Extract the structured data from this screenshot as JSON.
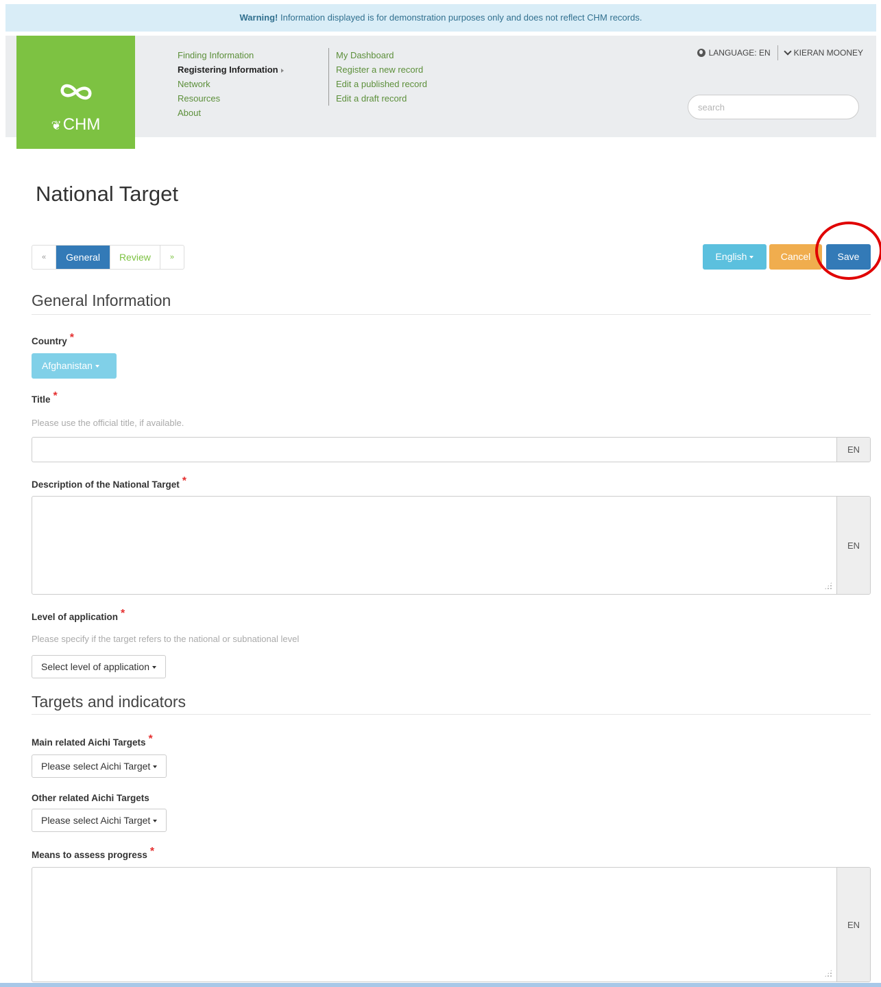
{
  "warning": {
    "strong": "Warning!",
    "text": " Information displayed is for demonstration purposes only and does not reflect CHM records."
  },
  "logo": {
    "text": "CHM"
  },
  "nav": {
    "primary": [
      {
        "label": "Finding Information"
      },
      {
        "label": "Registering Information"
      },
      {
        "label": "Network"
      },
      {
        "label": "Resources"
      },
      {
        "label": "About"
      }
    ],
    "secondary": [
      {
        "label": "My Dashboard"
      },
      {
        "label": "Register a new record"
      },
      {
        "label": "Edit a published record"
      },
      {
        "label": "Edit a draft record"
      }
    ]
  },
  "topbar": {
    "language": "LANGUAGE: EN",
    "user": "KIERAN MOONEY",
    "search_placeholder": "search"
  },
  "page": {
    "title": "National Target"
  },
  "tabs": {
    "prev": "«",
    "general": "General",
    "review": "Review",
    "next": "»"
  },
  "actions": {
    "english": "English",
    "cancel": "Cancel",
    "save": "Save"
  },
  "sections": {
    "general": "General Information",
    "targets": "Targets and indicators"
  },
  "fields": {
    "country": {
      "label": "Country",
      "required": "*",
      "value": "Afghanistan"
    },
    "title": {
      "label": "Title",
      "required": "*",
      "help": "Please use the official title, if available.",
      "value": "",
      "lang": "EN"
    },
    "description": {
      "label": "Description of the National Target",
      "required": "*",
      "value": "",
      "lang": "EN"
    },
    "level": {
      "label": "Level of application",
      "required": "*",
      "help": "Please specify if the target refers to the national or subnational level",
      "value": "Select level of application"
    },
    "main_aichi": {
      "label": "Main related Aichi Targets",
      "required": "*",
      "value": "Please select Aichi Target"
    },
    "other_aichi": {
      "label": "Other related Aichi Targets",
      "value": "Please select Aichi Target"
    },
    "means": {
      "label": "Means to assess progress",
      "required": "*",
      "value": "",
      "lang": "EN"
    }
  },
  "colors": {
    "brand_green": "#7dc242",
    "primary_blue": "#337ab7",
    "info_blue": "#5bc0de",
    "warning_orange": "#f0ad4e",
    "highlight_red": "#e00000"
  }
}
